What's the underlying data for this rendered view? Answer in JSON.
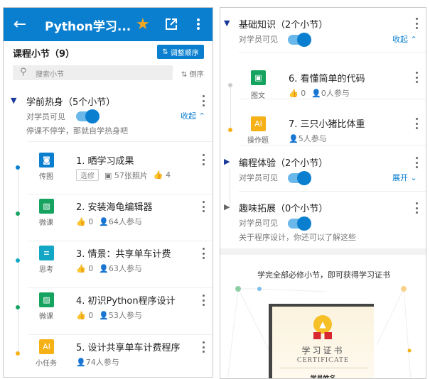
{
  "header": {
    "title": "Python学习...",
    "back_icon": "arrow-left-icon",
    "star_icon": "star-icon",
    "share_icon": "external-link-icon",
    "more_icon": "more-vertical-icon",
    "accent": "#0a7fd0",
    "star_color": "#f5a623"
  },
  "course": {
    "title": "课程小节（9）",
    "reorder_label": "调整顺序",
    "search_placeholder": "搜索小节",
    "sort_label": "倒序"
  },
  "sections": [
    {
      "title": "学前热身（5个小节）",
      "visible_label": "对学员可见",
      "toggle_on": true,
      "action": "收起",
      "desc": "停课不停学，那就自学热身吧"
    },
    {
      "title": "基础知识（2个小节）",
      "visible_label": "对学员可见",
      "toggle_on": true,
      "action": "收起"
    },
    {
      "title": "编程体验（2个小节）",
      "visible_label": "对学员可见",
      "toggle_on": true,
      "action": "展开"
    },
    {
      "title": "趣味拓展（0个小节）",
      "visible_label": "对学员可见",
      "toggle_on": true,
      "desc": "关于程序设计，你还可以了解这些"
    }
  ],
  "items": [
    {
      "title": "1. 晒学习成果",
      "type": "传图",
      "icon": "camera-icon",
      "color": "#0a7fd0",
      "tag": "选修",
      "photos": "57张照片",
      "likes": "4"
    },
    {
      "title": "2. 安装海龟编辑器",
      "type": "微课",
      "icon": "image-icon",
      "color": "#16a35f",
      "likes": "0",
      "participants": "64人参与"
    },
    {
      "title": "3. 情景：共享单车计费",
      "type": "思考",
      "icon": "document-icon",
      "color": "#12a7c4",
      "likes": "0",
      "participants": "63人参与"
    },
    {
      "title": "4. 初识Python程序设计",
      "type": "微课",
      "icon": "image-icon",
      "color": "#16a35f",
      "likes": "0",
      "participants": "53人参与"
    },
    {
      "title": "5. 设计共享单车计费程序",
      "type": "小任务",
      "icon": "ai-icon",
      "icon_text": "AI",
      "color": "#f5b116",
      "participants": "74人参与"
    },
    {
      "title": "6. 看懂简单的代码",
      "type": "图文",
      "icon": "image-text-icon",
      "color": "#16a35f",
      "likes": "0",
      "participants": "0人参与"
    },
    {
      "title": "7. 三只小猪比体重",
      "type": "操作题",
      "icon": "ai-icon",
      "icon_text": "AI",
      "color": "#f5b116",
      "participants": "5人参与"
    }
  ],
  "certificate": {
    "caption": "学完全部必修小节，即可获得学习证书",
    "title_cn": "学习证书",
    "title_en": "CERTIFICATE",
    "field": "学员姓名"
  }
}
